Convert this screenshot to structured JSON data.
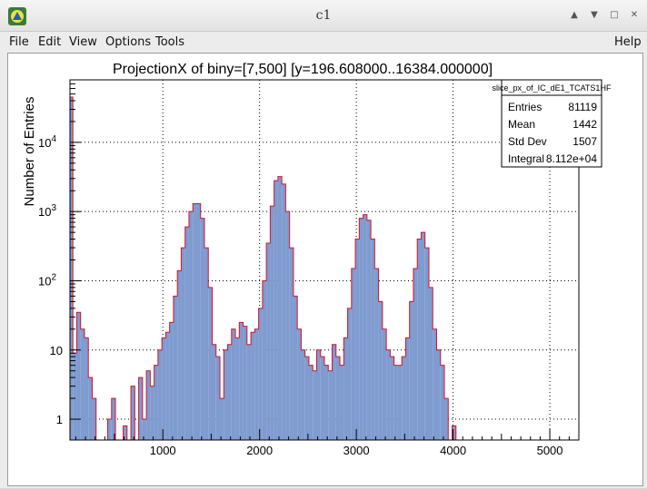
{
  "window": {
    "title": "c1",
    "icon": "root-logo-icon",
    "controls": [
      "up-arrow-icon",
      "down-arrow-icon",
      "maximize-icon",
      "close-icon"
    ]
  },
  "menubar": {
    "file": "File",
    "edit": "Edit",
    "view": "View",
    "options": "Options",
    "tools": "Tools",
    "help": "Help"
  },
  "stats": {
    "name": "slice_px_of_IC_dE1_TCATS1HF",
    "rows": [
      {
        "label": "Entries",
        "value": "81119"
      },
      {
        "label": "Mean",
        "value": "1442"
      },
      {
        "label": "Std Dev",
        "value": "1507"
      },
      {
        "label": "Integral",
        "value": "8.112e+04"
      }
    ]
  },
  "colors": {
    "fill": "#7f9bcf",
    "line": "#d0142c",
    "grid": "#000000"
  },
  "chart_data": {
    "type": "bar",
    "title": "ProjectionX of biny=[7,500] [y=196.608000..16384.000000]",
    "xlabel": "",
    "ylabel": "Number of Entries",
    "log_y": true,
    "grid": true,
    "xlim": [
      40,
      5300
    ],
    "ylim": [
      0.5,
      80000
    ],
    "x_ticks": [
      1000,
      2000,
      3000,
      4000,
      5000
    ],
    "y_ticks": [
      {
        "value": 1,
        "base": "1",
        "exp": ""
      },
      {
        "value": 10,
        "base": "10",
        "exp": ""
      },
      {
        "value": 100,
        "base": "10",
        "exp": "2"
      },
      {
        "value": 1000,
        "base": "10",
        "exp": "3"
      },
      {
        "value": 10000,
        "base": "10",
        "exp": "4"
      }
    ],
    "legend": "top-right",
    "x": [
      50,
      90,
      130,
      170,
      210,
      250,
      290,
      330,
      370,
      410,
      450,
      490,
      530,
      570,
      610,
      650,
      690,
      730,
      770,
      810,
      850,
      890,
      930,
      970,
      1010,
      1050,
      1090,
      1130,
      1170,
      1210,
      1250,
      1290,
      1330,
      1370,
      1410,
      1450,
      1490,
      1530,
      1570,
      1610,
      1650,
      1690,
      1730,
      1770,
      1810,
      1850,
      1890,
      1930,
      1970,
      2010,
      2050,
      2090,
      2130,
      2170,
      2210,
      2250,
      2290,
      2330,
      2370,
      2410,
      2450,
      2490,
      2530,
      2570,
      2610,
      2650,
      2690,
      2730,
      2770,
      2810,
      2850,
      2890,
      2930,
      2970,
      3010,
      3050,
      3090,
      3130,
      3170,
      3210,
      3250,
      3290,
      3330,
      3370,
      3410,
      3450,
      3490,
      3530,
      3570,
      3610,
      3650,
      3690,
      3730,
      3770,
      3810,
      3850,
      3890,
      3930,
      3970,
      4010,
      4050,
      4090,
      4130,
      4170,
      4210,
      4250,
      4290,
      4330,
      4370,
      4410,
      4450,
      4490,
      4530,
      4570,
      4610,
      4650,
      4690,
      4730,
      4770,
      4810,
      4850,
      4890,
      4930,
      4970,
      5010,
      5050,
      5090,
      5130,
      5170,
      5210
    ],
    "values": [
      45000,
      9,
      35,
      20,
      15,
      4,
      2,
      0,
      0,
      0,
      1,
      2,
      0,
      0,
      0.8,
      0,
      3,
      0,
      4,
      1,
      5,
      3,
      6,
      10,
      15,
      18,
      25,
      60,
      140,
      300,
      600,
      1000,
      1300,
      1300,
      800,
      300,
      80,
      12,
      8,
      2,
      10,
      12,
      20,
      15,
      25,
      22,
      12,
      18,
      20,
      40,
      100,
      350,
      1200,
      2800,
      3200,
      2500,
      1000,
      300,
      60,
      20,
      10,
      8,
      6,
      5,
      10,
      8,
      6,
      5,
      12,
      8,
      6,
      15,
      40,
      150,
      400,
      800,
      900,
      750,
      400,
      150,
      50,
      20,
      10,
      8,
      6,
      6,
      8,
      15,
      50,
      150,
      400,
      500,
      300,
      80,
      20,
      10,
      6,
      2,
      0,
      0.8,
      0,
      0,
      0,
      0,
      0,
      0,
      0,
      0,
      0,
      0,
      0,
      0,
      0,
      0,
      0,
      0,
      0,
      0,
      0,
      0,
      0,
      0,
      0,
      0,
      0,
      0,
      0,
      0,
      0
    ]
  }
}
